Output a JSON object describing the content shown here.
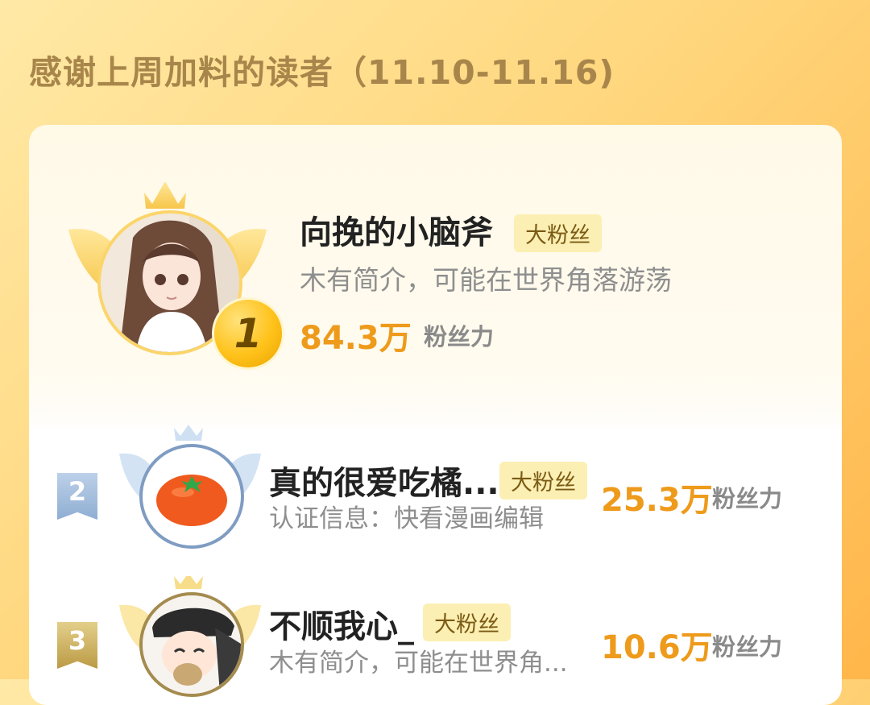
{
  "title": "感谢上周加料的读者（11.10-11.16)",
  "readers": [
    {
      "rank": "1",
      "name": "向挽的小脑斧",
      "badge": "大粉丝",
      "bio": "木有简介，可能在世界角落游荡",
      "score": "84.3万",
      "score_label": "粉丝力",
      "avatar_icon": "anime-girl-avatar"
    },
    {
      "rank": "2",
      "name": "真的很爱吃橘...",
      "badge": "大粉丝",
      "bio": "认证信息：快看漫画编辑",
      "score": "25.3万",
      "score_label": "粉丝力",
      "avatar_icon": "tangerine-avatar"
    },
    {
      "rank": "3",
      "name": "不顺我心_",
      "badge": "大粉丝",
      "bio": "木有简介，可能在世界角...",
      "score": "10.6万",
      "score_label": "粉丝力",
      "avatar_icon": "cartoon-boy-avatar"
    }
  ],
  "colors": {
    "accent": "#ee9a1b",
    "title": "#a8864b",
    "badge_bg": "#fcefb3",
    "silver": "#8faed3",
    "bronze": "#bb9a45"
  }
}
